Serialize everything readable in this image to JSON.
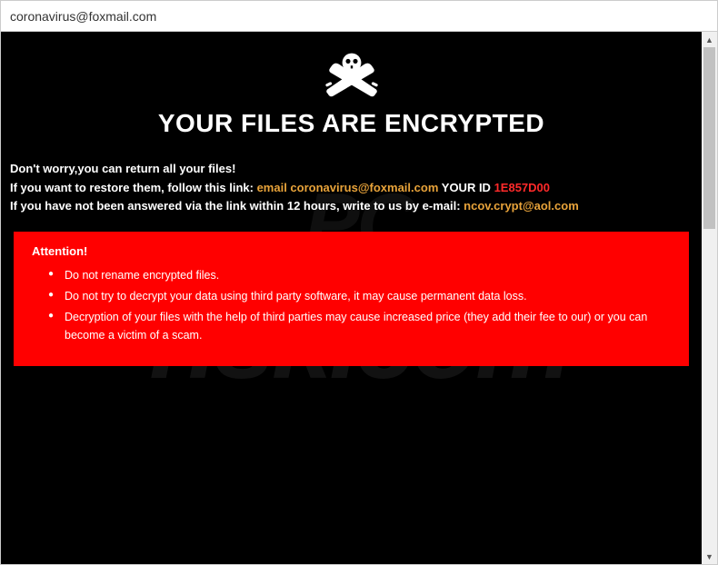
{
  "window": {
    "title": "coronavirus@foxmail.com"
  },
  "heading": "YOUR FILES ARE ENCRYPTED",
  "body": {
    "line1": "Don't worry,you can return all your files!",
    "line2_prefix": "If you want to restore them, follow this link: ",
    "line2_email_label": "email coronavirus@foxmail.com",
    "line2_id_label": "  YOUR ID ",
    "line2_id_value": "1E857D00",
    "line3_prefix": "If you have not been answered via the link within 12 hours, write to us by e-mail: ",
    "line3_email": "ncov.crypt@aol.com"
  },
  "attention": {
    "title": "Attention!",
    "items": [
      "Do not rename encrypted files.",
      "Do not try to decrypt your data using third party software, it may cause permanent data loss.",
      "Decryption of your files with the help of third parties may cause increased price (they add their fee to our) or you can become a victim of a scam."
    ]
  },
  "watermark": {
    "top": "PC",
    "bottom": "risk.com"
  }
}
